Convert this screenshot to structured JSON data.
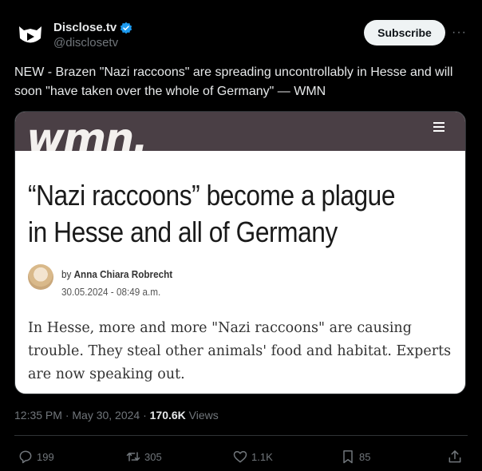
{
  "account": {
    "display_name": "Disclose.tv",
    "handle": "@disclosetv",
    "subscribe_label": "Subscribe",
    "more_label": "···"
  },
  "tweet": {
    "text": "NEW - Brazen \"Nazi raccoons\" are spreading uncontrollably in Hesse and will soon \"have taken over the whole of Germany\" — WMN"
  },
  "card": {
    "logo": "wmn.",
    "headline": "“Nazi raccoons” become a plague in Hesse and all of Germany",
    "author_prefix": "by ",
    "author": "Anna Chiara Robrecht",
    "date": "30.05.2024 - 08:49 a.m.",
    "lead": "In Hesse, more and more \"Nazi raccoons\" are causing trouble. They steal other animals' food and habitat. Experts are now speaking out."
  },
  "meta": {
    "time_date": "12:35 PM · May 30, 2024 · ",
    "views_count": "170.6K",
    "views_label": " Views"
  },
  "actions": {
    "replies": "199",
    "reposts": "305",
    "likes": "1.1K",
    "bookmarks": "85"
  },
  "colors": {
    "background": "#000000",
    "verified": "#1d9bf0",
    "card_header": "#4a3f45"
  }
}
